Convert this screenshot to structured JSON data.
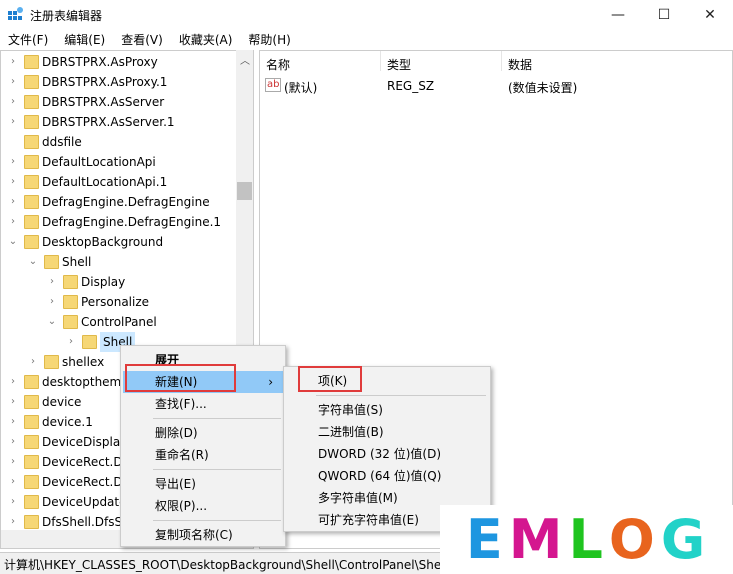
{
  "window": {
    "title": "注册表编辑器",
    "minimize": "—",
    "maximize": "☐",
    "close": "✕"
  },
  "menubar": [
    "文件(F)",
    "编辑(E)",
    "查看(V)",
    "收藏夹(A)",
    "帮助(H)"
  ],
  "tree": [
    {
      "label": "DBRSTPRX.AsProxy",
      "level": 0,
      "arrow": "›"
    },
    {
      "label": "DBRSTPRX.AsProxy.1",
      "level": 0,
      "arrow": "›"
    },
    {
      "label": "DBRSTPRX.AsServer",
      "level": 0,
      "arrow": "›"
    },
    {
      "label": "DBRSTPRX.AsServer.1",
      "level": 0,
      "arrow": "›"
    },
    {
      "label": "ddsfile",
      "level": 0,
      "arrow": ""
    },
    {
      "label": "DefaultLocationApi",
      "level": 0,
      "arrow": "›"
    },
    {
      "label": "DefaultLocationApi.1",
      "level": 0,
      "arrow": "›"
    },
    {
      "label": "DefragEngine.DefragEngine",
      "level": 0,
      "arrow": "›"
    },
    {
      "label": "DefragEngine.DefragEngine.1",
      "level": 0,
      "arrow": "›"
    },
    {
      "label": "DesktopBackground",
      "level": 0,
      "arrow": "⌄"
    },
    {
      "label": "Shell",
      "level": 1,
      "arrow": "⌄"
    },
    {
      "label": "Display",
      "level": 2,
      "arrow": "›"
    },
    {
      "label": "Personalize",
      "level": 2,
      "arrow": "›"
    },
    {
      "label": "ControlPanel",
      "level": 2,
      "arrow": "⌄"
    },
    {
      "label": "Shell",
      "level": 3,
      "arrow": "›",
      "selected": true
    },
    {
      "label": "shellex",
      "level": 1,
      "arrow": "›"
    },
    {
      "label": "desktopthemepackfile",
      "level": 0,
      "arrow": "›"
    },
    {
      "label": "device",
      "level": 0,
      "arrow": "›"
    },
    {
      "label": "device.1",
      "level": 0,
      "arrow": "›"
    },
    {
      "label": "DeviceDisplayObject",
      "level": 0,
      "arrow": "›"
    },
    {
      "label": "DeviceRect.DeviceRect",
      "level": 0,
      "arrow": "›"
    },
    {
      "label": "DeviceRect.DeviceRect.1",
      "level": 0,
      "arrow": "›"
    },
    {
      "label": "DeviceUpdate",
      "level": 0,
      "arrow": "›"
    },
    {
      "label": "DfsShell.DfsShell",
      "level": 0,
      "arrow": "›"
    }
  ],
  "values": {
    "headers": [
      "名称",
      "类型",
      "数据"
    ],
    "rows": [
      {
        "name": "(默认)",
        "type": "REG_SZ",
        "data": "(数值未设置)",
        "icon": "ab"
      }
    ]
  },
  "context_menu": [
    {
      "label": "展开",
      "bold": true
    },
    {
      "label": "新建(N)",
      "highlight": true,
      "submenu": true,
      "arrow": "›"
    },
    {
      "label": "查找(F)..."
    },
    {
      "sep": true
    },
    {
      "label": "删除(D)"
    },
    {
      "label": "重命名(R)"
    },
    {
      "sep": true
    },
    {
      "label": "导出(E)"
    },
    {
      "label": "权限(P)..."
    },
    {
      "sep": true
    },
    {
      "label": "复制项名称(C)"
    }
  ],
  "submenu": [
    {
      "label": "项(K)"
    },
    {
      "sep": true
    },
    {
      "label": "字符串值(S)"
    },
    {
      "label": "二进制值(B)"
    },
    {
      "label": "DWORD (32 位)值(D)"
    },
    {
      "label": "QWORD (64 位)值(Q)"
    },
    {
      "label": "多字符串值(M)"
    },
    {
      "label": "可扩充字符串值(E)"
    }
  ],
  "status": "计算机\\HKEY_CLASSES_ROOT\\DesktopBackground\\Shell\\ControlPanel\\Shell",
  "logo": {
    "letters": [
      "E",
      "M",
      "L",
      "O",
      "G"
    ],
    "colors": [
      "#1e96e0",
      "#d4168f",
      "#1fc41f",
      "#e8641e",
      "#22d2c8"
    ]
  }
}
